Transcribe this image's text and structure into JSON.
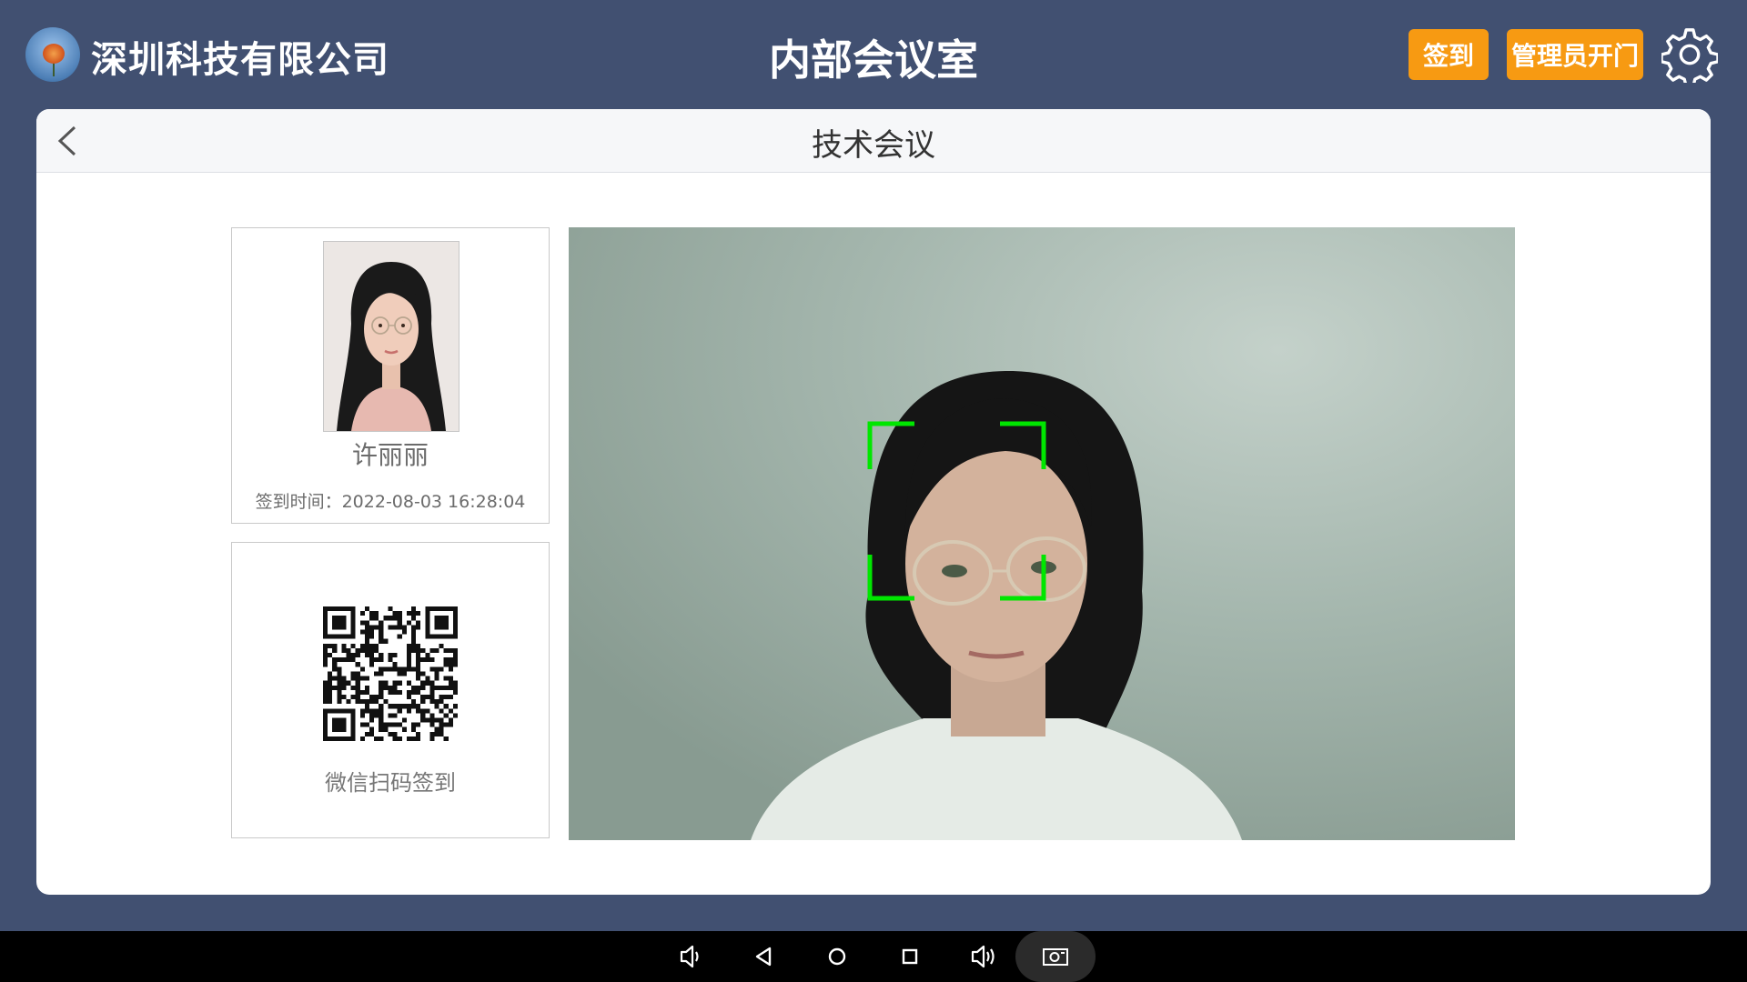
{
  "header": {
    "company": "深圳科技有限公司",
    "room": "内部会议室",
    "signin_button": "签到",
    "admin_button": "管理员开门",
    "logo_icon": "flower-logo-icon",
    "settings_icon": "gear-icon"
  },
  "meeting": {
    "title": "技术会议",
    "back_icon": "chevron-left-icon"
  },
  "person": {
    "name": "许丽丽",
    "signin_time": "签到时间：2022-08-03 16:28:04"
  },
  "qr": {
    "label": "微信扫码签到",
    "icon": "qr-code-icon"
  },
  "camera": {
    "face_box_color": "#00e600"
  },
  "navbar": {
    "icons": [
      "volume-down-icon",
      "back-triangle-icon",
      "home-circle-icon",
      "recents-square-icon",
      "volume-up-icon",
      "screenshot-icon"
    ]
  },
  "colors": {
    "background": "#415071",
    "accent": "#f79a12",
    "card": "#ffffff"
  }
}
